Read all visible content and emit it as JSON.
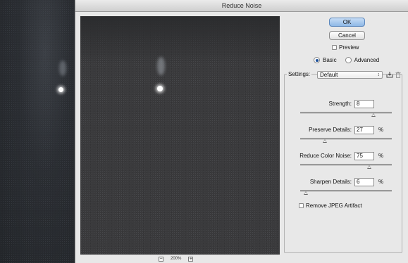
{
  "dialog": {
    "title": "Reduce Noise"
  },
  "buttons": {
    "ok": "OK",
    "cancel": "Cancel"
  },
  "preview_checkbox": {
    "label": "Preview",
    "checked": false
  },
  "mode": {
    "basic_label": "Basic",
    "advanced_label": "Advanced",
    "selected": "Basic"
  },
  "settings": {
    "label": "Settings:",
    "selected": "Default",
    "arrows": "↕"
  },
  "params": [
    {
      "label": "Strength:",
      "value": "8",
      "unit": "",
      "slider_value": 8,
      "slider_max": 10
    },
    {
      "label": "Preserve Details:",
      "value": "27",
      "unit": "%",
      "slider_value": 27,
      "slider_max": 100
    },
    {
      "label": "Reduce Color Noise:",
      "value": "75",
      "unit": "%",
      "slider_value": 75,
      "slider_max": 100
    },
    {
      "label": "Sharpen Details:",
      "value": "6",
      "unit": "%",
      "slider_value": 6,
      "slider_max": 100
    }
  ],
  "remove_jpeg": {
    "label": "Remove JPEG Artifact",
    "checked": false
  },
  "zoom": {
    "level": "200%",
    "minus": "−",
    "plus": "+"
  },
  "icons": {
    "save_preset": "save-preset-icon",
    "delete_preset": "trash-icon"
  }
}
